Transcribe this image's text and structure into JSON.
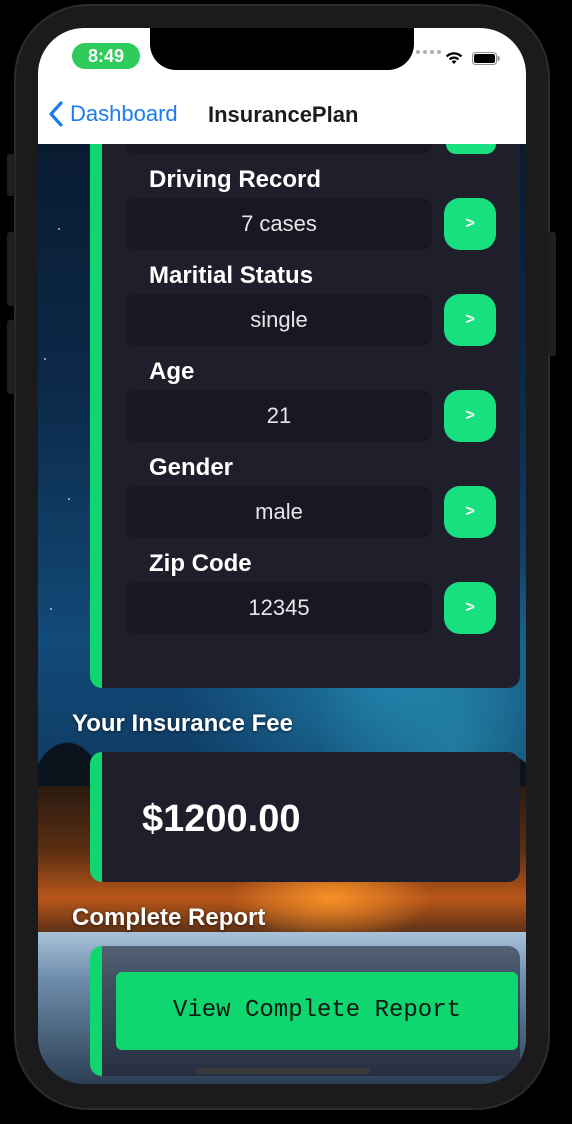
{
  "status_bar": {
    "time": "8:49"
  },
  "nav": {
    "back_label": "Dashboard",
    "title": "InsurancePlan"
  },
  "fields": [
    {
      "label": "Driving Record",
      "value": "7 cases",
      "button": ">"
    },
    {
      "label": "Maritial Status",
      "value": "single",
      "button": ">"
    },
    {
      "label": "Age",
      "value": "21",
      "button": ">"
    },
    {
      "label": "Gender",
      "value": "male",
      "button": ">"
    },
    {
      "label": "Zip Code",
      "value": "12345",
      "button": ">"
    }
  ],
  "fee_section": {
    "title": "Your Insurance Fee",
    "amount": "$1200.00"
  },
  "report_section": {
    "title": "Complete Report",
    "button_label": "View Complete Report"
  },
  "colors": {
    "accent": "#0fd66e",
    "button_green": "#19e07f",
    "card_bg": "#1f1f2b",
    "link_blue": "#1a7cf0"
  }
}
